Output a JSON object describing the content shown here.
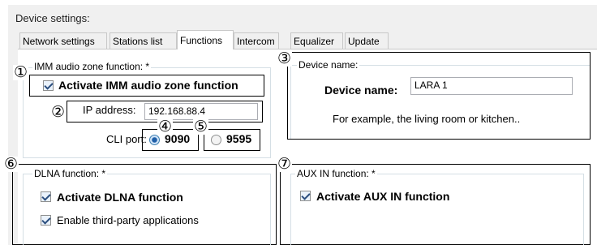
{
  "settings": {
    "title": "Device settings:"
  },
  "tabs": [
    {
      "label": "Network settings"
    },
    {
      "label": "Stations list"
    },
    {
      "label": "Functions"
    },
    {
      "label": "Intercom"
    },
    {
      "label": "Equalizer"
    },
    {
      "label": "Update"
    }
  ],
  "active_tab": "Functions",
  "imm": {
    "group_title": "IMM audio zone function: *",
    "activate_label": "Activate IMM audio zone function",
    "activate_checked": true,
    "ip_label": "IP address:",
    "ip_value": "192.168.88.4",
    "cli_label": "CLI port:",
    "port_options": [
      {
        "label": "9090",
        "selected": true
      },
      {
        "label": "9595",
        "selected": false
      }
    ]
  },
  "device": {
    "group_title": "Device name:",
    "name_label": "Device name:",
    "name_value": "LARA 1",
    "hint": "For example, the living room or kitchen.."
  },
  "dlna": {
    "group_title": "DLNA function: *",
    "activate_label": "Activate DLNA function",
    "activate_checked": true,
    "thirdparty_label": "Enable third-party applications",
    "thirdparty_checked": true
  },
  "aux": {
    "group_title": "AUX IN function: *",
    "activate_label": "Activate AUX IN function",
    "activate_checked": true
  },
  "callouts": [
    "①",
    "②",
    "③",
    "④",
    "⑤",
    "⑥",
    "⑦"
  ]
}
